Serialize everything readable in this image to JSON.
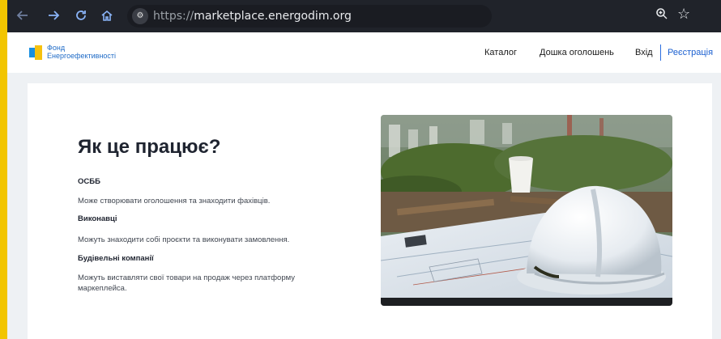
{
  "browser": {
    "url_scheme": "https://",
    "url_host": "marketplace.energodim.org",
    "icons": [
      "back-icon",
      "forward-icon",
      "reload-icon",
      "home-icon",
      "site-settings-icon",
      "zoom-icon",
      "bookmark-star-icon"
    ]
  },
  "site": {
    "logo_line1": "Фонд",
    "logo_line2": "Енергоефективності",
    "nav": {
      "catalog": "Каталог",
      "board": "Дошка оголошень",
      "login": "Вхід",
      "register": "Реєстрація"
    }
  },
  "main": {
    "title": "Як це працює?",
    "sections": [
      {
        "heading": "ОСББ",
        "text": "Може створювати оголошення та знаходити фахівців."
      },
      {
        "heading": "Виконавці",
        "text": "Можуть знаходити собі проєкти та виконувати замовлення."
      },
      {
        "heading": "Будівельні компанії",
        "text": "Можуть виставляти свої товари на продаж через платформу маркеплейса."
      }
    ]
  },
  "colors": {
    "accent_yellow": "#f2c500",
    "link_blue": "#1a5fd0",
    "logo_blue": "#1a8fe0",
    "logo_yellow": "#f6c10f"
  }
}
